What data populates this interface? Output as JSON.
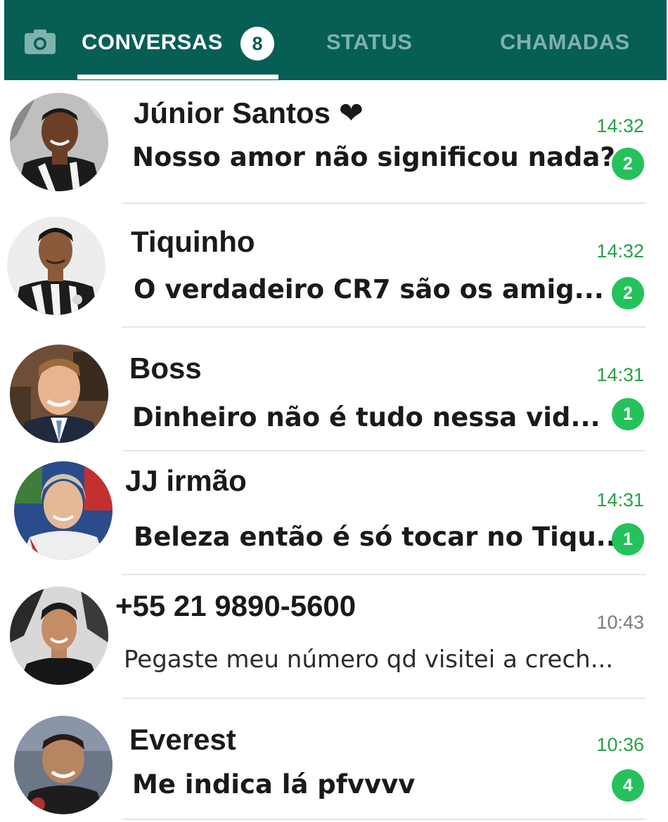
{
  "tabs": {
    "conversas": "CONVERSAS",
    "conversas_badge": "8",
    "status": "STATUS",
    "chamadas": "CHAMADAS"
  },
  "chats": [
    {
      "name": "Júnior Santos ❤",
      "message": "Nosso amor não significou nada?",
      "time": "14:32",
      "unread": "2"
    },
    {
      "name": "Tiquinho",
      "message": "O verdadeiro CR7 são os amig...",
      "time": "14:32",
      "unread": "2"
    },
    {
      "name": "Boss",
      "message": "Dinheiro não é tudo nessa vid...",
      "time": "14:31",
      "unread": "1"
    },
    {
      "name": "JJ irmão",
      "message": "Beleza então é só tocar no Tiqu....",
      "time": "14:31",
      "unread": "1"
    },
    {
      "name": "+55 21 9890-5600",
      "message": "Pegaste meu número qd visitei a crech...",
      "time": "10:43",
      "unread": ""
    },
    {
      "name": "Everest",
      "message": "Me indica lá pfvvvv",
      "time": "10:36",
      "unread": "4"
    }
  ],
  "colors": {
    "header": "#075e54",
    "accent": "#25c25c",
    "time_unread": "#25a244"
  },
  "icons": {
    "camera": "camera-icon"
  }
}
